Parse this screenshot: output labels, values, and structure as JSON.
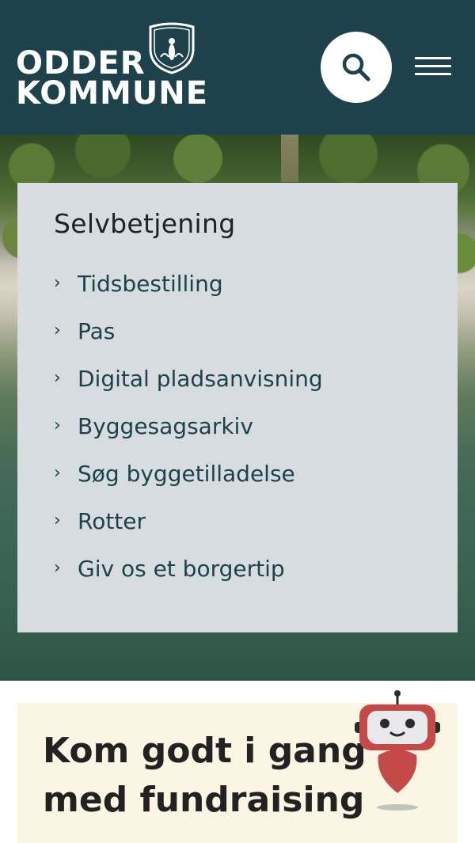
{
  "header": {
    "logo_line1": "ODDER",
    "logo_line2": "KOMMUNE",
    "background_color": "#1d424b",
    "search_icon": "search-icon",
    "menu_icon": "hamburger-menu-icon"
  },
  "selfservice": {
    "title": "Selvbetjening",
    "items": [
      {
        "label": "Tidsbestilling"
      },
      {
        "label": "Pas"
      },
      {
        "label": "Digital pladsanvisning"
      },
      {
        "label": "Byggesagsarkiv"
      },
      {
        "label": "Søg byggetilladelse"
      },
      {
        "label": "Rotter"
      },
      {
        "label": "Giv os et borgertip"
      }
    ],
    "chevron_icon": "chevron-right-icon",
    "background_color": "#d6dce0",
    "link_color": "#1d424b"
  },
  "promo": {
    "title": "Kom godt i gang med fundraising",
    "background_color": "#fbf6e4"
  },
  "chatbot": {
    "icon": "robot-chatbot-icon",
    "color": "#c44a4a"
  }
}
